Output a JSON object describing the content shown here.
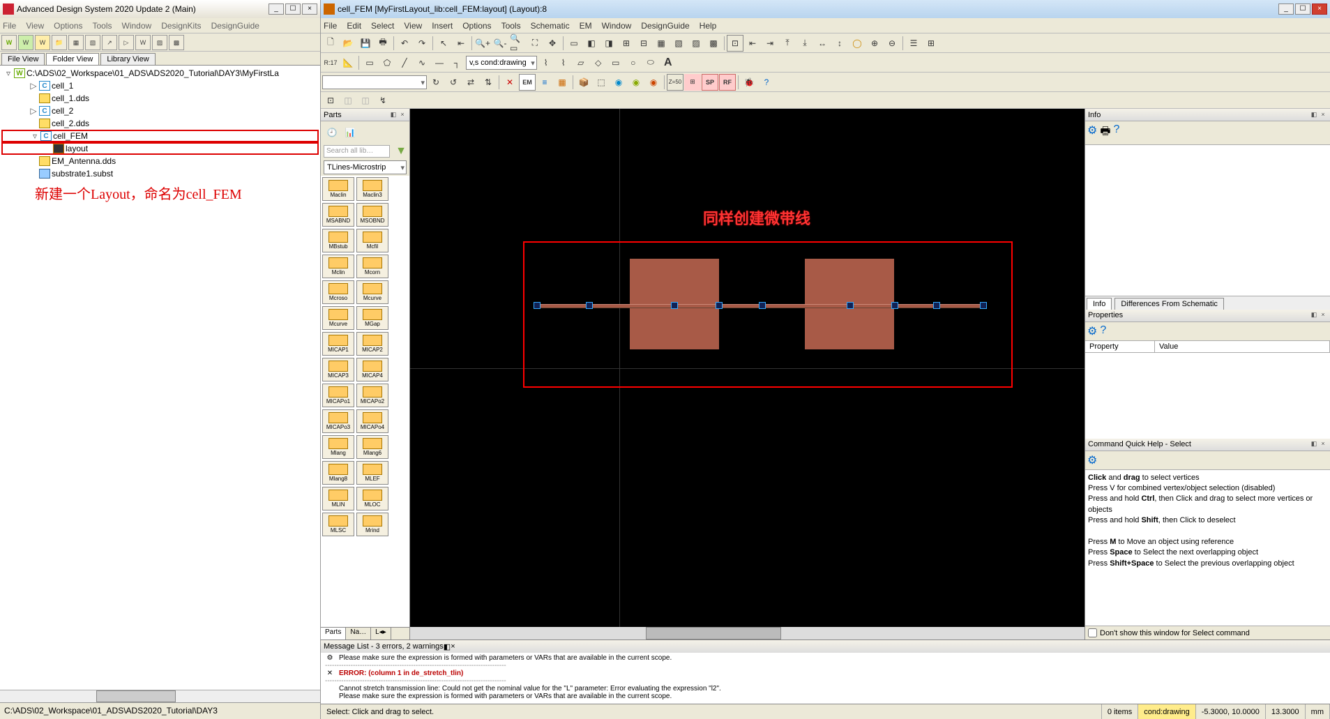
{
  "main": {
    "title": "Advanced Design System 2020 Update 2 (Main)",
    "menu": [
      "File",
      "View",
      "Options",
      "Tools",
      "Window",
      "DesignKits",
      "DesignGuide"
    ],
    "tabs": [
      "File View",
      "Folder View",
      "Library View"
    ],
    "activeTab": 1,
    "treeRoot": "C:\\ADS\\02_Workspace\\01_ADS\\ADS2020_Tutorial\\DAY3\\MyFirstLa",
    "tree": [
      {
        "lvl": 2,
        "ic": "c",
        "txt": "cell_1",
        "exp": "▷"
      },
      {
        "lvl": 2,
        "ic": "dd",
        "txt": "cell_1.dds"
      },
      {
        "lvl": 2,
        "ic": "c",
        "txt": "cell_2",
        "exp": "▷"
      },
      {
        "lvl": 2,
        "ic": "dd",
        "txt": "cell_2.dds"
      },
      {
        "lvl": 2,
        "ic": "c",
        "txt": "cell_FEM",
        "exp": "▿",
        "boxStart": true
      },
      {
        "lvl": 3,
        "ic": "la",
        "txt": "layout",
        "boxEnd": true
      },
      {
        "lvl": 2,
        "ic": "dd",
        "txt": "EM_Antenna.dds"
      },
      {
        "lvl": 2,
        "ic": "sub",
        "txt": "substrate1.subst"
      }
    ],
    "annotation": "新建一个Layout，命名为cell_FEM",
    "status": "C:\\ADS\\02_Workspace\\01_ADS\\ADS2020_Tutorial\\DAY3"
  },
  "layout": {
    "title": "cell_FEM [MyFirstLayout_lib:cell_FEM:layout] (Layout):8",
    "menu": [
      "File",
      "Edit",
      "Select",
      "View",
      "Insert",
      "Options",
      "Tools",
      "Schematic",
      "EM",
      "Window",
      "DesignGuide",
      "Help"
    ],
    "layerCombo": "v,s cond:drawing",
    "rulerLabel": "R:17",
    "parts": {
      "title": "Parts",
      "searchPlaceholder": "Search all lib…",
      "category": "TLines-Microstrip",
      "items": [
        [
          "Maclin",
          "Maclin3"
        ],
        [
          "MSABND",
          "MSOBND"
        ],
        [
          "MBstub",
          "Mcfil"
        ],
        [
          "Mclin",
          "Mcorn"
        ],
        [
          "Mcroso",
          "Mcurve"
        ],
        [
          "Mcurve",
          "MGap"
        ],
        [
          "MICAP1",
          "MICAP2"
        ],
        [
          "MICAP3",
          "MICAP4"
        ],
        [
          "MICAPo1",
          "MICAPo2"
        ],
        [
          "MICAPo3",
          "MICAPo4"
        ],
        [
          "Mlang",
          "Mlang6"
        ],
        [
          "Mlang8",
          "MLEF"
        ],
        [
          "MLIN",
          "MLOC"
        ],
        [
          "MLSC",
          "Mrind"
        ]
      ],
      "tabs": [
        "Parts",
        "Na…",
        "L◂▸"
      ]
    },
    "canvasAnno": "同样创建微带线",
    "info": {
      "title": "Info",
      "tabs": [
        "Info",
        "Differences From Schematic"
      ]
    },
    "props": {
      "title": "Properties",
      "cols": [
        "Property",
        "Value"
      ]
    },
    "help": {
      "title": "Command Quick Help - Select",
      "lines": [
        {
          "b1": "Click",
          "t1": " and ",
          "b2": "drag",
          "t2": " to select vertices"
        },
        {
          "t": "Press V for combined vertex/object selection (disabled)"
        },
        {
          "t1": "Press and hold ",
          "b": "Ctrl",
          "t2": ", then Click and drag to select more vertices or objects"
        },
        {
          "t1": "Press and hold ",
          "b": "Shift",
          "t2": ", then Click to deselect"
        },
        {
          "sp": true
        },
        {
          "t1": "Press ",
          "b": "M",
          "t2": " to Move an object using reference"
        },
        {
          "t1": "Press ",
          "b": "Space",
          "t2": " to Select the next overlapping object"
        },
        {
          "t1": "Press ",
          "b": "Shift+Space",
          "t2": " to Select the previous overlapping object"
        }
      ],
      "checkbox": "Don't show this window for Select command"
    },
    "msgs": {
      "title": "Message List - 3 errors, 2 warnings",
      "lines": [
        {
          "ic": "⚙",
          "txt": "Please make sure the expression is formed with parameters or VARs that are available in the current scope."
        },
        {
          "ic": "✕",
          "txt": "ERROR: (column 1 in de_stretch_tlin)",
          "err": true
        },
        {
          "ic": "",
          "txt": "Cannot stretch transmission line: Could not get the nominal value for the \"L\" parameter: Error evaluating the expression \"l2\"."
        },
        {
          "ic": "",
          "txt": "Please make sure the expression is formed with parameters or VARs that are available in the current scope."
        }
      ]
    },
    "status": {
      "hint": "Select: Click and drag to select.",
      "items": "0 items",
      "layer": "cond:drawing",
      "coords": "-5.3000, 10.0000",
      "extra": "13.3000",
      "unit": "mm"
    }
  }
}
